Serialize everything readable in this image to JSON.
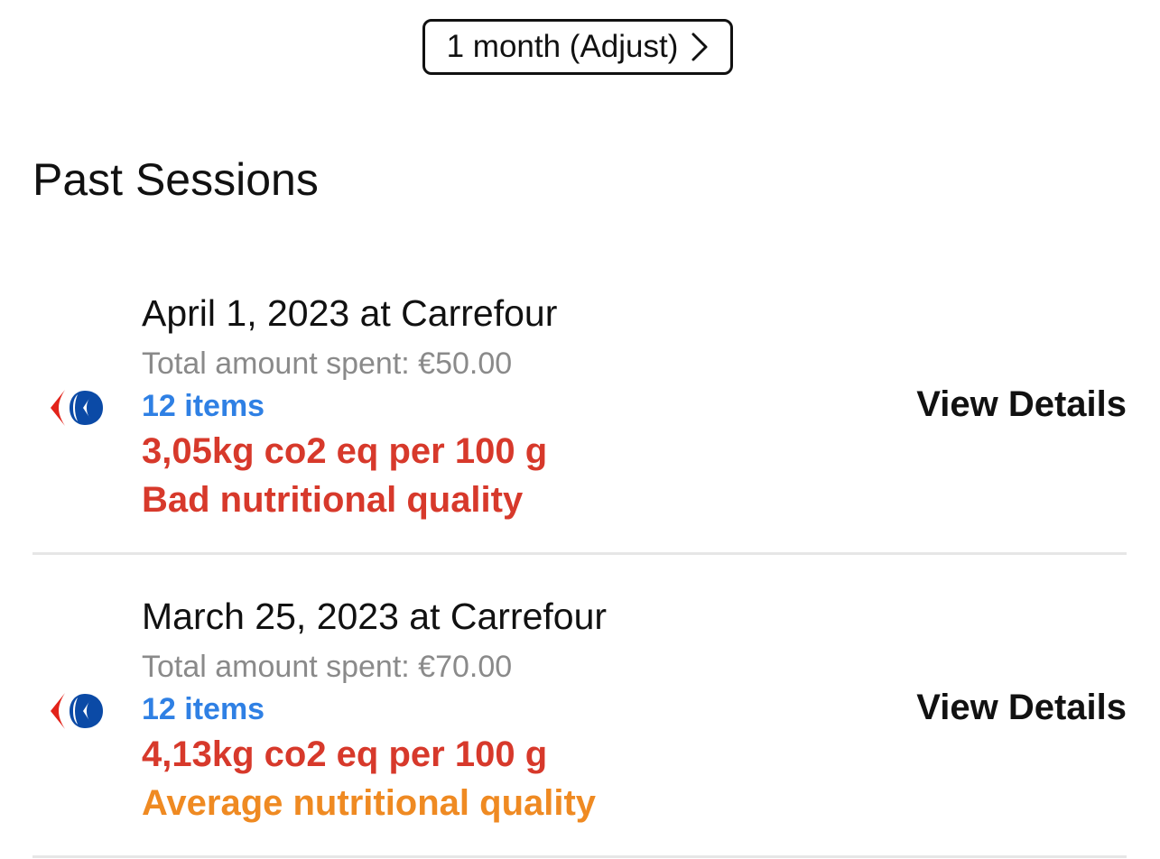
{
  "period": {
    "label": "1 month (Adjust)",
    "icon": "chevron-right-icon"
  },
  "section_title": "Past Sessions",
  "sessions": [
    {
      "title": "April 1, 2023 at Carrefour",
      "amount": "Total amount spent: €50.00",
      "items": "12 items",
      "co2": "3,05kg co2 eq per 100 g",
      "quality": "Bad nutritional quality",
      "quality_color": "#d7392b",
      "action": "View Details",
      "logo": "carrefour-logo-icon"
    },
    {
      "title": "March 25, 2023 at Carrefour",
      "amount": "Total amount spent: €70.00",
      "items": "12 items",
      "co2": "4,13kg co2 eq per 100 g",
      "quality": "Average nutritional quality",
      "quality_color": "#ef8a22",
      "action": "View Details",
      "logo": "carrefour-logo-icon"
    }
  ],
  "colors": {
    "items_blue": "#2f80e4",
    "co2_red": "#d7392b",
    "muted_gray": "#8a8a8a",
    "carrefour_red": "#e2231a",
    "carrefour_blue": "#0b4aa6"
  }
}
